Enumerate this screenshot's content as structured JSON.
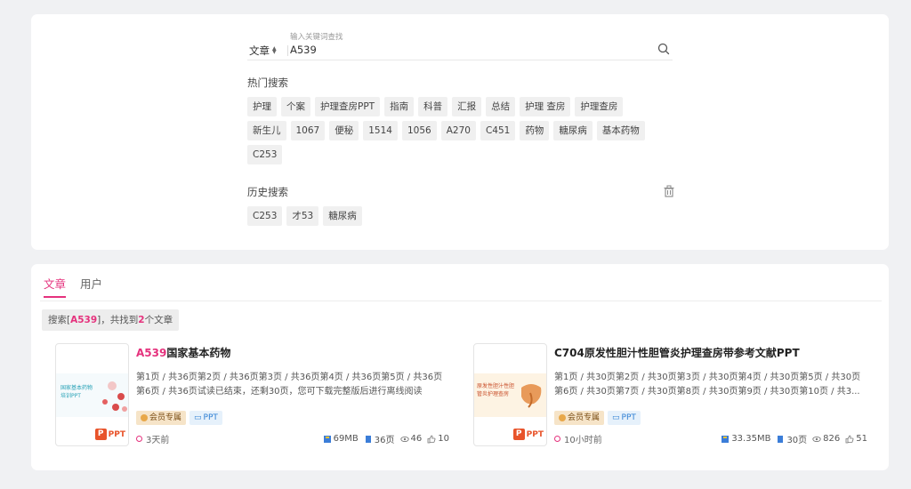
{
  "search": {
    "type_label": "文章",
    "placeholder": "输入关键词查找",
    "value": "A539"
  },
  "hot": {
    "label": "热门搜索",
    "tags": [
      "护理",
      "个案",
      "护理查房PPT",
      "指南",
      "科普",
      "汇报",
      "总结",
      "护理 查房",
      "护理查房",
      "新生儿",
      "1067",
      "便秘",
      "1514",
      "1056",
      "A270",
      "C451",
      "药物",
      "糖尿病",
      "基本药物",
      "C253"
    ]
  },
  "history": {
    "label": "历史搜索",
    "tags": [
      "C253",
      "才53",
      "糖尿病"
    ]
  },
  "tabs": [
    {
      "label": "文章"
    },
    {
      "label": "用户"
    }
  ],
  "summary": {
    "prefix": "搜索[",
    "keyword": "A539",
    "middle": "]，共找到",
    "count": "2",
    "suffix": "个文章"
  },
  "results": [
    {
      "title_hl": "A539",
      "title_rest": "国家基本药物",
      "thumb_text": "国家基本药物\n培训PPT",
      "desc": "第1页 / 共36页第2页 / 共36页第3页 / 共36页第4页 / 共36页第5页 / 共36页第6页 / 共36页试读已结束，还剩30页，您可下载完整版后进行离线阅读",
      "vip": "会员专属",
      "type": "PPT",
      "time": "3天前",
      "size": "69MB",
      "pages": "36页",
      "views": "46",
      "likes": "10",
      "ppt": "PPT"
    },
    {
      "title_hl": "",
      "title_rest": "C704原发性胆汁性胆管炎护理查房带参考文献PPT",
      "thumb_text": "原发性胆汁性胆\n管炎护理查房",
      "desc": "第1页 / 共30页第2页 / 共30页第3页 / 共30页第4页 / 共30页第5页 / 共30页第6页 / 共30页第7页 / 共30页第8页 / 共30页第9页 / 共30页第10页 / 共3...",
      "vip": "会员专属",
      "type": "PPT",
      "time": "10小时前",
      "size": "33.35MB",
      "pages": "30页",
      "views": "826",
      "likes": "51",
      "ppt": "PPT"
    }
  ],
  "colors": {
    "accent": "#e5327d",
    "ppt": "#e8532a",
    "vip_bg": "#f6e4c8",
    "type_bg": "#e6f1fb"
  },
  "icons": {
    "search": "search-icon",
    "trash": "trash-icon",
    "file_size": "file-size-icon",
    "pages": "pages-icon",
    "views": "eye-icon",
    "likes": "thumb-up-icon"
  }
}
